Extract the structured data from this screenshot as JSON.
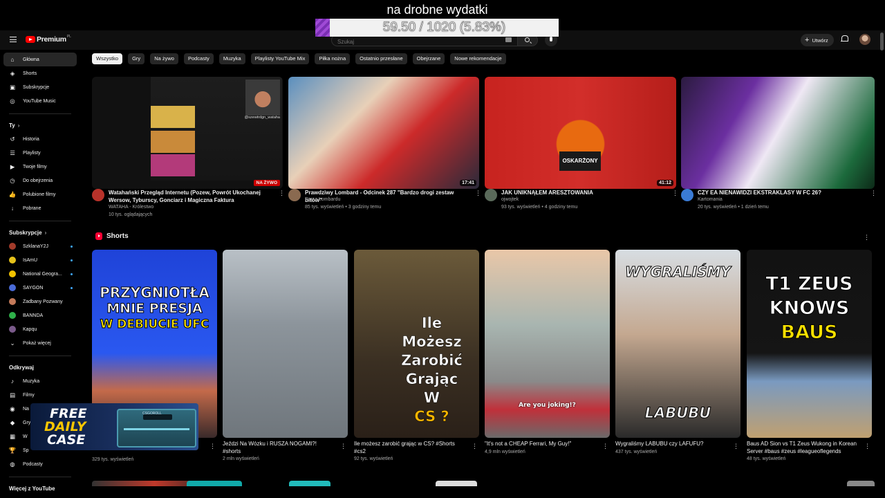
{
  "overlay": {
    "title": "na drobne wydatki",
    "progress_text": "59.50 / 1020 (5.83%)",
    "progress_fraction": 0.0583,
    "fill_color": "#8e3cc7"
  },
  "header": {
    "brand": "Premium",
    "brand_sup": "PL",
    "search_placeholder": "Szukaj",
    "create_label": "Utwórz"
  },
  "chips": [
    "Wszystko",
    "Gry",
    "Na żywo",
    "Podcasty",
    "Muzyka",
    "Playlisty YouTube Mix",
    "Piłka nożna",
    "Ostatnio przesłane",
    "Obejrzane",
    "Nowe rekomendacje"
  ],
  "sidebar": {
    "main": [
      {
        "label": "Główna",
        "icon": "home-icon",
        "glyph": "⌂"
      },
      {
        "label": "Shorts",
        "icon": "shorts-icon",
        "glyph": "◈"
      },
      {
        "label": "Subskrypcje",
        "icon": "subscriptions-icon",
        "glyph": "▣"
      },
      {
        "label": "YouTube Music",
        "icon": "music-icon",
        "glyph": "◎"
      }
    ],
    "you_heading": "Ty",
    "you": [
      {
        "label": "Historia",
        "icon": "history-icon",
        "glyph": "↺"
      },
      {
        "label": "Playlisty",
        "icon": "playlists-icon",
        "glyph": "☰"
      },
      {
        "label": "Twoje filmy",
        "icon": "your-videos-icon",
        "glyph": "▶"
      },
      {
        "label": "Do obejrzenia",
        "icon": "watch-later-icon",
        "glyph": "◷"
      },
      {
        "label": "Polubione filmy",
        "icon": "like-icon",
        "glyph": "👍"
      },
      {
        "label": "Pobrane",
        "icon": "download-icon",
        "glyph": "↓"
      }
    ],
    "subs_heading": "Subskrypcje",
    "subs": [
      {
        "label": "SzklanaY2J",
        "color": "#a23b2a",
        "dot": true
      },
      {
        "label": "IsAmU",
        "color": "#e6c21a",
        "dot": true
      },
      {
        "label": "National Geogra...",
        "color": "#f2c200",
        "dot": true
      },
      {
        "label": "SAYGON",
        "color": "#4a6bd8",
        "dot": true
      },
      {
        "label": "Zadbany Pozwany",
        "color": "#c47a5a",
        "dot": false
      },
      {
        "label": "BANNDA",
        "color": "#2fb04a",
        "dot": false
      },
      {
        "label": "Kapqu",
        "color": "#7a5a8a",
        "dot": false
      }
    ],
    "show_more": "Pokaż więcej",
    "explore_heading": "Odkrywaj",
    "explore": [
      {
        "label": "Muzyka",
        "icon": "music-note-icon",
        "glyph": "♪"
      },
      {
        "label": "Filmy",
        "icon": "film-icon",
        "glyph": "▤"
      },
      {
        "label": "Na żywo",
        "icon": "live-icon",
        "glyph": "◉"
      },
      {
        "label": "Gry",
        "icon": "gaming-icon",
        "glyph": "◆"
      },
      {
        "label": "W",
        "icon": "news-icon",
        "glyph": "▦"
      },
      {
        "label": "Sp",
        "icon": "trophy-icon",
        "glyph": "🏆"
      },
      {
        "label": "Podcasty",
        "icon": "podcast-icon",
        "glyph": "◍"
      }
    ],
    "more_from_youtube": "Więcej z YouTube"
  },
  "videos": [
    {
      "title": "Watahański Przegląd Internetu (Pozew, Powrót Ukochanej Wersow, Tyburscy, Gonciarz i Magiczna Faktura",
      "channel": "WATAHA - Królestwo",
      "stats": "10 tys. oglądających",
      "badge": "NA ŻYWO",
      "watermark": "@szewtrdgn_wataha",
      "avatar_color": "#b8322a"
    },
    {
      "title": "Prawdziwy Lombard - Odcinek 287 \"Bardzo drogi zestaw bitów\"",
      "channel": "Pan z Lombardu",
      "stats": "85 tys. wyświetleń • 3 godziny temu",
      "duration": "17:41",
      "avatar_color": "#8a6a50"
    },
    {
      "title": "JAK UNIKNĄŁEM ARESZTOWANIA",
      "channel": "ojwojtek",
      "stats": "93 tys. wyświetleń • 4 godziny temu",
      "duration": "41:12",
      "sign_text": "OSKARŻONY",
      "avatar_color": "#5a6a5a"
    },
    {
      "title": "CZY EA NIENAWIDZI EKSTRAKLASY W FC 26?",
      "channel": "Kartomania",
      "stats": "20 tys. wyświetleń • 1 dzień temu",
      "avatar_color": "#3a7bd5"
    }
  ],
  "shorts_heading": "Shorts",
  "shorts": [
    {
      "title": "",
      "views": "329 tys. wyświetleń",
      "overlay_lines": [
        "PRZYGNIOTŁA",
        "MNIE PRESJA",
        "W DEBIUCIE UFC"
      ]
    },
    {
      "title": "Jeździ Na Wózku i RUSZA NOGAMI?! #shorts",
      "views": "2 mln wyświetleń",
      "overlay_lines": []
    },
    {
      "title": "Ile możesz zarobić grając w CS? #Shorts #cs2",
      "views": "92 tys. wyświetleń",
      "overlay_lines": [
        "Ile",
        "Możesz",
        "Zarobić",
        "Grając",
        "W",
        "CS ?"
      ]
    },
    {
      "title": "\"It's not a CHEAP Ferrari, My Guy!\"",
      "views": "4,9 mln wyświetleń",
      "overlay_lines": [
        "Are you joking!?"
      ]
    },
    {
      "title": "Wygraliśmy LABUBU czy LAFUFU?",
      "views": "437 tys. wyświetleń",
      "overlay_lines": [
        "WYGRALIŚMY",
        "LABUBU"
      ]
    },
    {
      "title": "Baus AD Sion vs T1 Zeus Wukong in Korean Server #baus #zeus #leagueoflegends",
      "views": "48 tys. wyświetleń",
      "overlay_lines": [
        "T1 ZEUS",
        "KNOWS",
        "BAUS"
      ]
    }
  ],
  "promo": {
    "lines": [
      "FREE",
      "DAILY",
      "CASE"
    ],
    "box_label": "CSGOROLL"
  }
}
